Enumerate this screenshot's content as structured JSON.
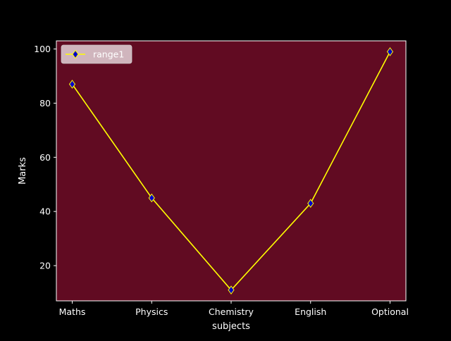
{
  "chart_data": {
    "type": "line",
    "categories": [
      "Maths",
      "Physics",
      "Chemistry",
      "English",
      "Optional"
    ],
    "series": [
      {
        "name": "range1",
        "values": [
          87,
          45,
          11,
          43,
          99
        ]
      }
    ],
    "xlabel": "subjects",
    "ylabel": "Marks",
    "ylim": [
      7,
      103
    ],
    "yticks": [
      20,
      40,
      60,
      80,
      100
    ],
    "grid": false,
    "legend": "top-left",
    "colors": {
      "figure_background": "#000000",
      "plot_background": "#610b22",
      "line": "#ffff00",
      "marker_fill": "#0000cc",
      "marker_edge": "#ffff00",
      "axes": "#ffffff",
      "legend_background": "#e4d3d8"
    },
    "marker": "diamond"
  }
}
